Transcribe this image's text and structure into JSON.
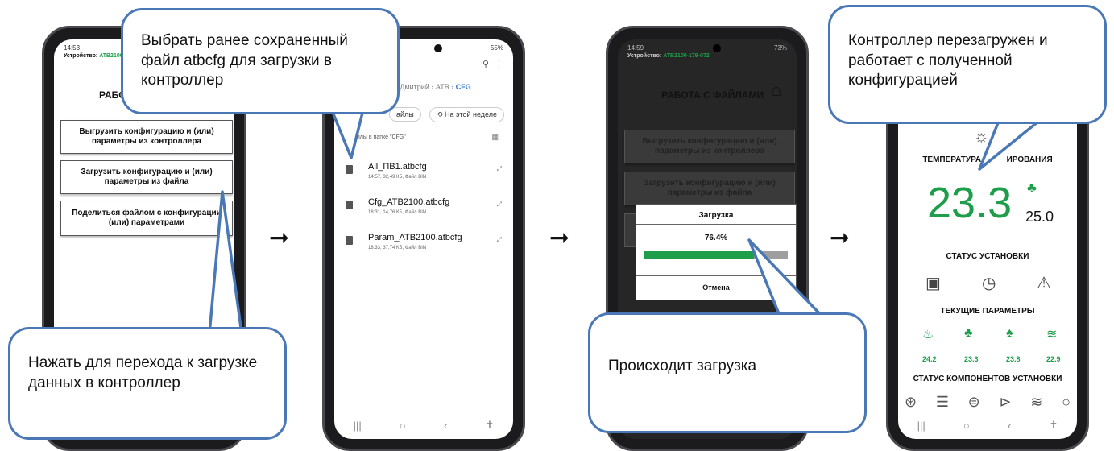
{
  "phone1": {
    "time": "14:53",
    "device_label": "Устройство:",
    "device_id": "ATB2100-",
    "title": "РАБО",
    "buttons": [
      "Выгрузить конфигурацию и (или) параметры из контроллера",
      "Загрузить конфигурацию и (или) параметры из файла",
      "Поделиться файлом с конфигурации (или) параметрами"
    ]
  },
  "phone2": {
    "battery": "55%",
    "breadcrumb": [
      "я Дмитрий",
      "ATB",
      "CFG"
    ],
    "chip_files": "айлы",
    "chip_week": "На этой неделе",
    "folder_label": "айлы в папке \"CFG\"",
    "files": [
      {
        "name": "All_ПВ1.atbcfg",
        "meta": "14:57, 32,49 КБ, Файл BIN"
      },
      {
        "name": "Cfg_ATB2100.atbcfg",
        "meta": "18:31, 14,76 КБ, Файл BIN"
      },
      {
        "name": "Param_ATB2100.atbcfg",
        "meta": "18:33, 37,74 КБ, Файл BIN"
      }
    ]
  },
  "phone3": {
    "time": "14:59",
    "battery": "73%",
    "device_label": "Устройство:",
    "device_id": "ATB2100-179-072",
    "title": "РАБОТА С ФАЙЛАМИ",
    "buttons": [
      "Выгрузить конфигурацию и (или) параметры из контроллера",
      "Загрузить конфигурацию и (или) параметры из файла"
    ],
    "dialog": {
      "title": "Загрузка",
      "percent": "76.4%",
      "progress": 0.764,
      "cancel": "Отмена"
    }
  },
  "phone4": {
    "temp_title": "ТЕМПЕРАТУРА Р",
    "temp_title_tail": "ИРОВАНИЯ",
    "temp_value": "23.3",
    "setpoint": "25.0",
    "status_title": "СТАТУС УСТАНОВКИ",
    "params_title": "ТЕКУЩИЕ ПАРАМЕТРЫ",
    "param_values": [
      "24.2",
      "23.3",
      "23.8",
      "22.9"
    ],
    "components_title": "СТАТУС КОМПОНЕНТОВ УСТАНОВКИ"
  },
  "callouts": {
    "c1": "Выбрать ранее сохраненный файл atbcfg для загрузки в контроллер",
    "c2": "Нажать для перехода к загрузке данных в контроллер",
    "c3": "Происходит загрузка",
    "c4": "Контроллер перезагружен и работает с полученной конфигурацией"
  },
  "colors": {
    "accent_green": "#1e9e4a",
    "callout_border": "#4a78b6",
    "progress_gray": "#9e9e9e"
  }
}
